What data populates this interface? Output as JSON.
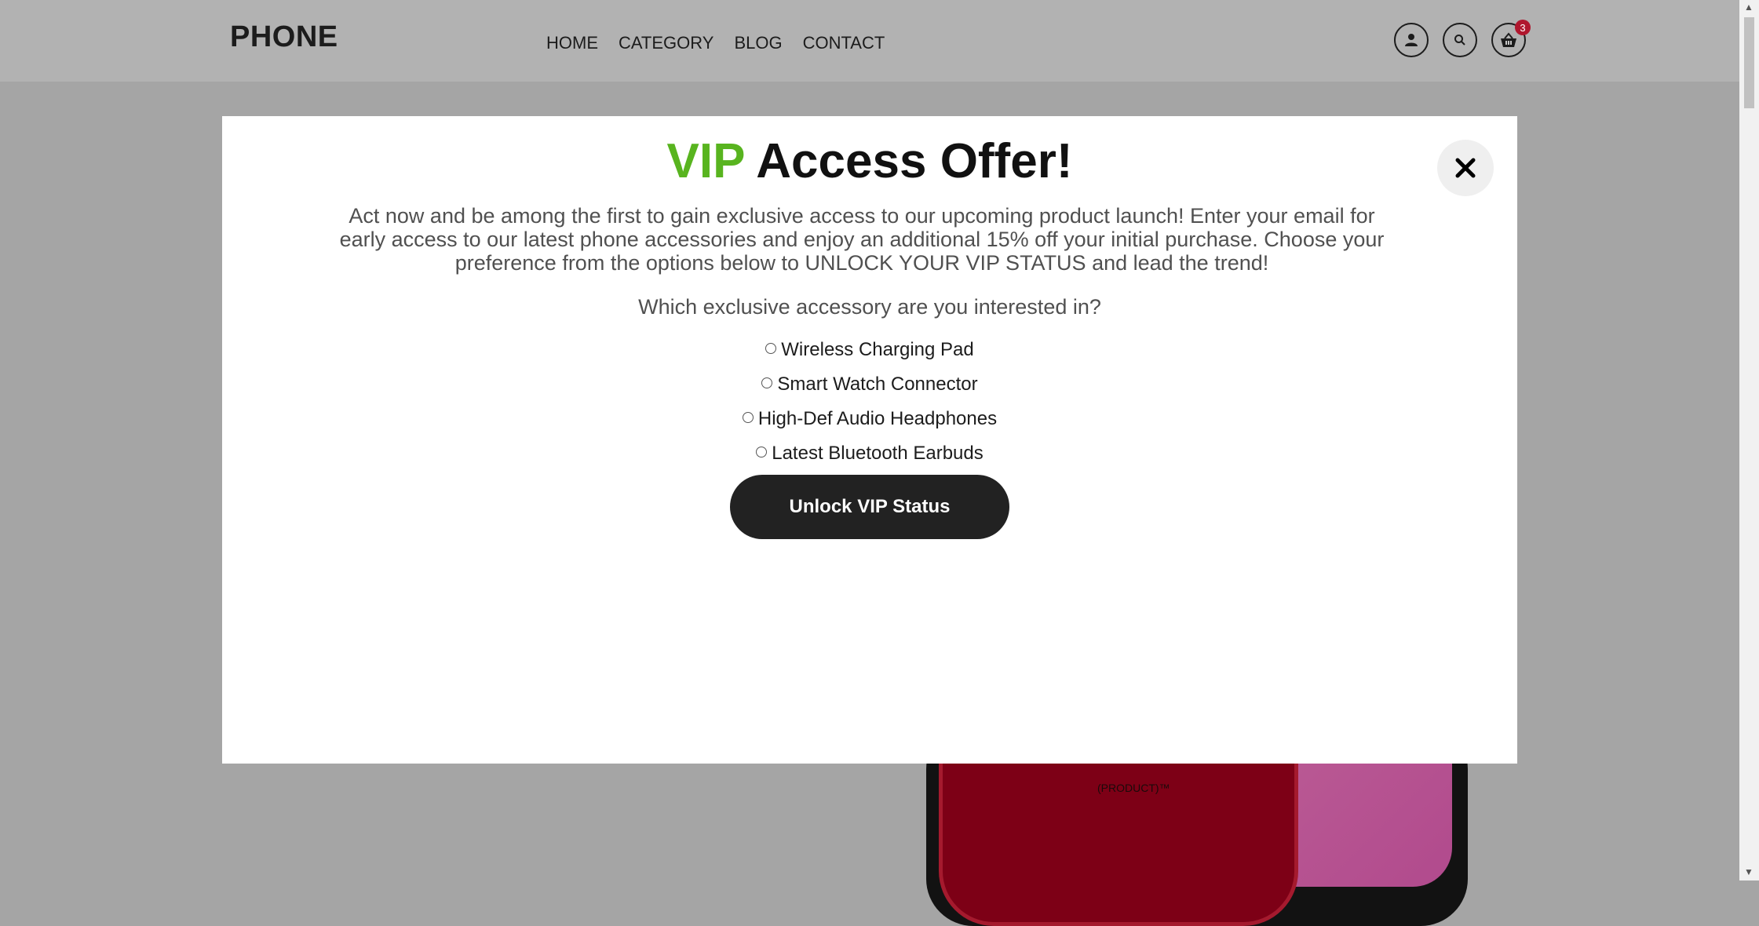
{
  "header": {
    "logo": "PHONE",
    "nav": [
      "HOME",
      "CATEGORY",
      "BLOG",
      "CONTACT"
    ],
    "icons": [
      "user-icon",
      "search-icon",
      "basket-icon"
    ],
    "cart_count": "3"
  },
  "background": {
    "product_mark": "(PRODUCT)™"
  },
  "modal": {
    "title_accent": "VIP",
    "title_rest": "Access Offer!",
    "close_icon": "close-icon",
    "description": "Act now and be among the first to gain exclusive access to our upcoming product launch! Enter your email for early access to our latest phone accessories and enjoy an additional 15% off your initial purchase. Choose your preference from the options below to UNLOCK YOUR VIP STATUS and lead the trend!",
    "question": "Which exclusive accessory are you interested in?",
    "options": [
      "Wireless Charging Pad",
      "Smart Watch Connector",
      "High-Def Audio Headphones",
      "Latest Bluetooth Earbuds"
    ],
    "cta": "Unlock VIP Status"
  },
  "colors": {
    "accent": "#58b41f",
    "badge": "#b0172e",
    "overlay": "#a5a5a5"
  }
}
